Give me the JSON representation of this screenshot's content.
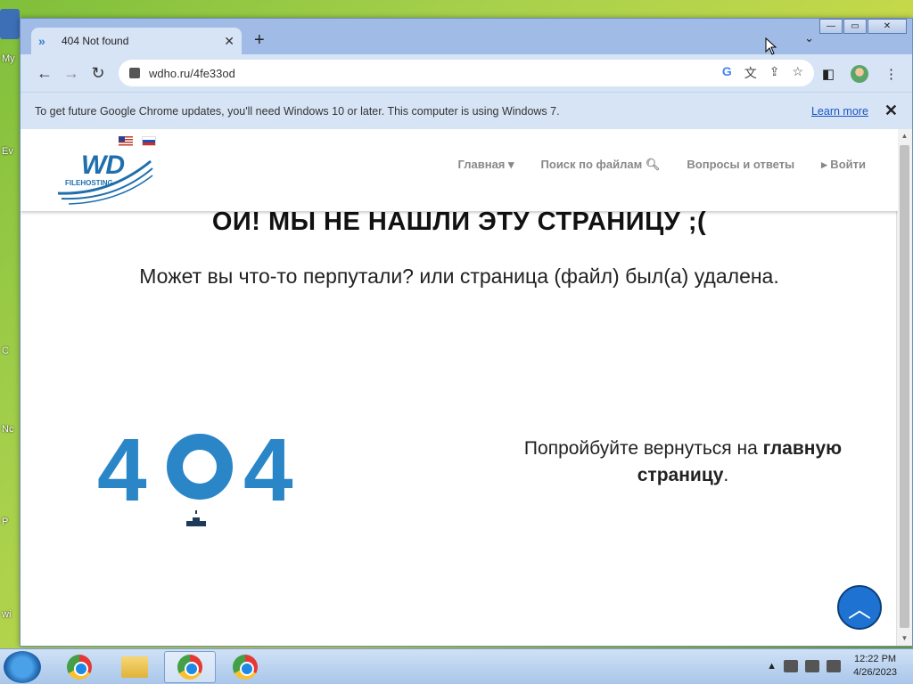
{
  "desktop": {
    "labels": [
      "My",
      "Ev",
      "C",
      "Nc",
      "P",
      "wi"
    ]
  },
  "browser": {
    "tab": {
      "title": "404 Not found"
    },
    "omnibox": {
      "url": "wdho.ru/4fe33od"
    },
    "infobar": {
      "message": "To get future Google Chrome updates, you'll need Windows 10 or later. This computer is using Windows 7.",
      "link": "Learn more"
    }
  },
  "site": {
    "logo_text": "WD",
    "logo_sub": "FILEHOSTING",
    "nav": [
      "Главная ▾",
      "Поиск по файлам 🔍︎",
      "Вопросы и ответы",
      "▸ Войти"
    ],
    "heading": "ОЙ! МЫ НЕ НАШЛИ ЭТУ СТРАНИЦУ ;(",
    "subheading": "Может вы что-то перпутали? или страница (файл) был(а) удалена.",
    "error_digit_left": "4",
    "error_digit_right": "4",
    "retry_prefix": "Попройбуйте вернуться на ",
    "retry_link": "главную страницу",
    "retry_suffix": "."
  },
  "taskbar": {
    "time": "12:22 PM",
    "date": "4/26/2023"
  }
}
